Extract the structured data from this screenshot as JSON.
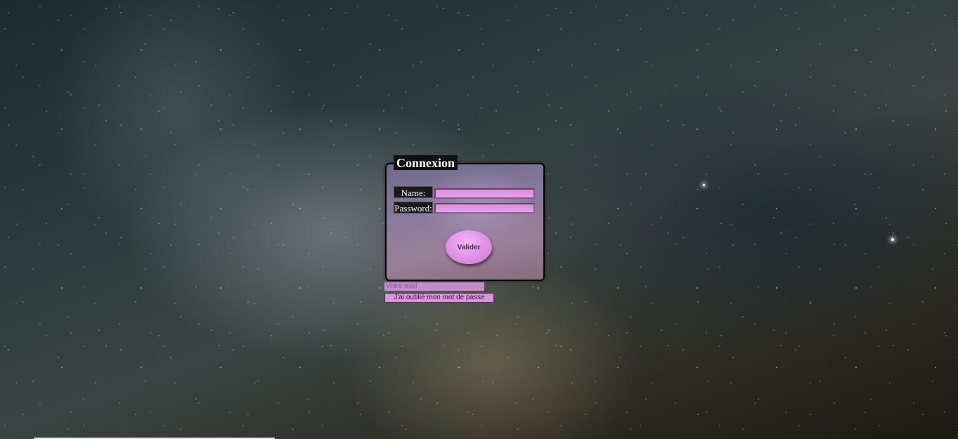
{
  "login": {
    "legend": "Connexion",
    "name_label": "Name:",
    "name_value": "",
    "password_label": "Password:",
    "password_value": "",
    "submit_label": "Valider"
  },
  "recovery": {
    "mail_placeholder": "Votre mail",
    "mail_value": "",
    "forgot_label": "J'ai oublié mon mot de passe"
  },
  "colors": {
    "field_pink": "#e08fe6",
    "legend_bg": "#111111",
    "panel_border": "#000000"
  }
}
